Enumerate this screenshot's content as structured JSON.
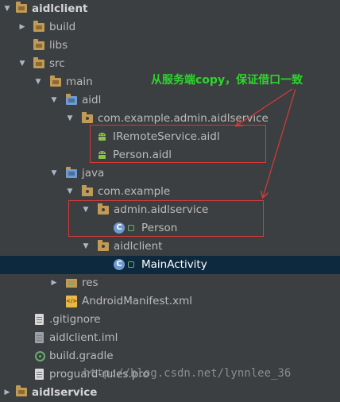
{
  "tree": {
    "root_label": "aidlclient",
    "build": "build",
    "libs": "libs",
    "src": "src",
    "main": "main",
    "aidl": "aidl",
    "aidl_package": "com.example.admin.aidlservice",
    "aidl_file1": "IRemoteService.aidl",
    "aidl_file2": "Person.aidl",
    "java": "java",
    "java_package": "com.example",
    "service_package": "admin.aidlservice",
    "person_class": "Person",
    "client_package": "aidlclient",
    "main_activity": "MainActivity",
    "res": "res",
    "manifest": "AndroidManifest.xml",
    "gitignore": ".gitignore",
    "iml": "aidlclient.iml",
    "build_gradle": "build.gradle",
    "proguard": "proguard-rules.pro",
    "next_module": "aidlservice"
  },
  "annotation": "从服务端copy，保证借口一致",
  "watermark": "http://blog.csdn.net/lynnlee_36",
  "colors": {
    "highlight_box": "#d83a3a",
    "annotation": "#2ed52e",
    "selection": "#0d293e"
  }
}
